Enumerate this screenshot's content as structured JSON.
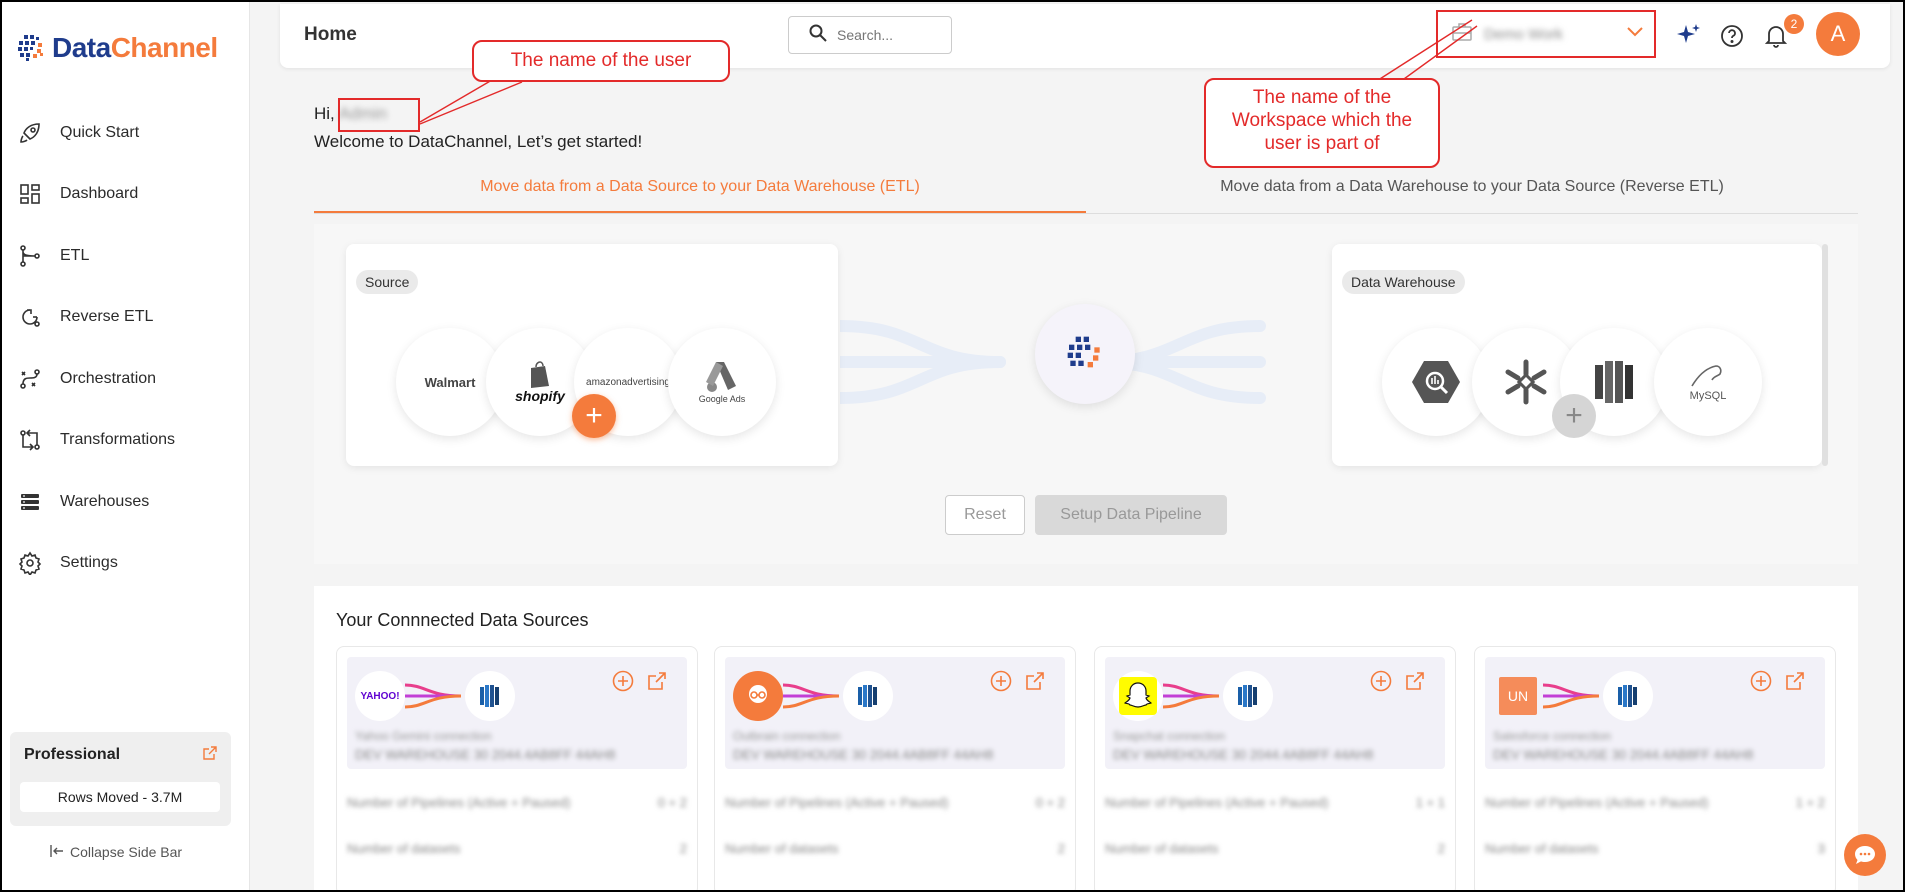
{
  "brand": {
    "name_part1": "Data",
    "name_part2": "Channel",
    "primary_color": "#1f3c8c",
    "accent_color": "#f47b3c"
  },
  "sidebar": {
    "items": [
      {
        "label": "Quick Start",
        "icon": "rocket-icon"
      },
      {
        "label": "Dashboard",
        "icon": "dashboard-icon"
      },
      {
        "label": "ETL",
        "icon": "etl-icon"
      },
      {
        "label": "Reverse ETL",
        "icon": "reverse-etl-icon"
      },
      {
        "label": "Orchestration",
        "icon": "orchestration-icon"
      },
      {
        "label": "Transformations",
        "icon": "transformations-icon"
      },
      {
        "label": "Warehouses",
        "icon": "warehouse-icon"
      },
      {
        "label": "Settings",
        "icon": "gear-icon"
      }
    ],
    "plan": {
      "title": "Professional",
      "rows_moved": "Rows Moved - 3.7M"
    },
    "collapse_label": "Collapse Side Bar"
  },
  "header": {
    "title": "Home",
    "search_placeholder": "Search...",
    "workspace_name": "Demo Work",
    "notification_count": "2",
    "avatar_initial": "A"
  },
  "greeting": {
    "hi": "Hi,",
    "user_name": "Admin",
    "welcome": "Welcome to DataChannel, Let’s get started!"
  },
  "tabs": [
    {
      "label": "Move data from a Data Source to your Data Warehouse (ETL)",
      "active": true
    },
    {
      "label": "Move data from a Data Warehouse to your Data Source (Reverse ETL)",
      "active": false
    }
  ],
  "pipeline": {
    "source_label": "Source",
    "warehouse_label": "Data Warehouse",
    "sources": [
      "Walmart",
      "shopify",
      "amazonadvertising",
      "Google Ads"
    ],
    "warehouses": [
      "BigQuery",
      "Snowflake",
      "Redshift",
      "MySQL"
    ],
    "reset_label": "Reset",
    "setup_label": "Setup Data Pipeline"
  },
  "connected": {
    "title": "Your Connnected Data Sources",
    "cards": [
      {
        "logo_text": "YAHOO!",
        "name": "Yahoo Gemini connection",
        "sub": "DEV WAREHOUSE 30 2044.4AB8FF 44AH8",
        "stat1_label": "Number of Pipelines (Active + Paused)",
        "stat1_value": "0 + 2",
        "stat2_label": "Number of datasets",
        "stat2_value": "2"
      },
      {
        "logo_text": "",
        "name": "Outbrain connection",
        "sub": "DEV WAREHOUSE 30 2044.4AB8FF 44AH8",
        "stat1_label": "Number of Pipelines (Active + Paused)",
        "stat1_value": "0 + 2",
        "stat2_label": "Number of datasets",
        "stat2_value": "2"
      },
      {
        "logo_text": "",
        "name": "Snapchat connection",
        "sub": "DEV WAREHOUSE 30 2044.4AB8FF 44AH8",
        "stat1_label": "Number of Pipelines (Active + Paused)",
        "stat1_value": "1 + 1",
        "stat2_label": "Number of datasets",
        "stat2_value": "2"
      },
      {
        "logo_text": "UN",
        "name": "Salesforce connection",
        "sub": "DEV WAREHOUSE 30 2044.4AB8FF 44AH8",
        "stat1_label": "Number of Pipelines (Active + Paused)",
        "stat1_value": "1 + 2",
        "stat2_label": "Number of datasets",
        "stat2_value": "3"
      }
    ]
  },
  "annotations": {
    "user_note": "The name of the user",
    "workspace_note_l1": "The name of the",
    "workspace_note_l2": "Workspace which the",
    "workspace_note_l3": "user is part of",
    "color": "#e32a2a"
  }
}
